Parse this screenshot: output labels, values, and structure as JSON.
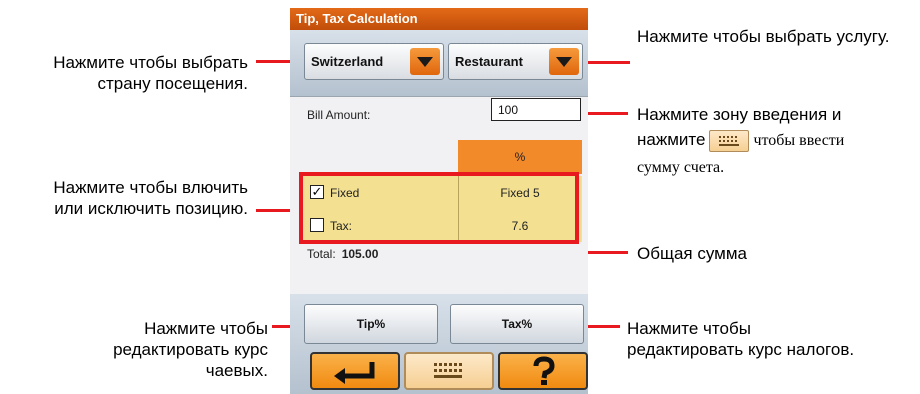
{
  "device": {
    "title": "Tip, Tax Calculation",
    "country": "Switzerland",
    "service": "Restaurant",
    "bill_label": "Bill Amount:",
    "bill_value": "100",
    "pct_header": "%",
    "rows": [
      {
        "label": "Fixed",
        "value": "Fixed 5",
        "checked": "✓"
      },
      {
        "label": "Tax:",
        "value": "7.6",
        "checked": ""
      }
    ],
    "total_label": "Total:",
    "total_value": "105.00",
    "tip_button": "Tip%",
    "tax_button": "Tax%"
  },
  "callouts": {
    "country": "Нажмите чтобы выбрать страну посещения.",
    "service": "Нажмите чтобы выбрать услугу.",
    "bill_part1": "Нажмите зону введения и",
    "bill_part2": "нажмите",
    "bill_part3": "чтобы ввести",
    "bill_part4": "сумму счета.",
    "toggle": "Нажмите чтобы влючить или исключить позицию.",
    "total": "Общая сумма",
    "tip": "Нажмите чтобы редактировать курс чаевых.",
    "tax": "Нажмите чтобы редактировать курс налогов."
  }
}
